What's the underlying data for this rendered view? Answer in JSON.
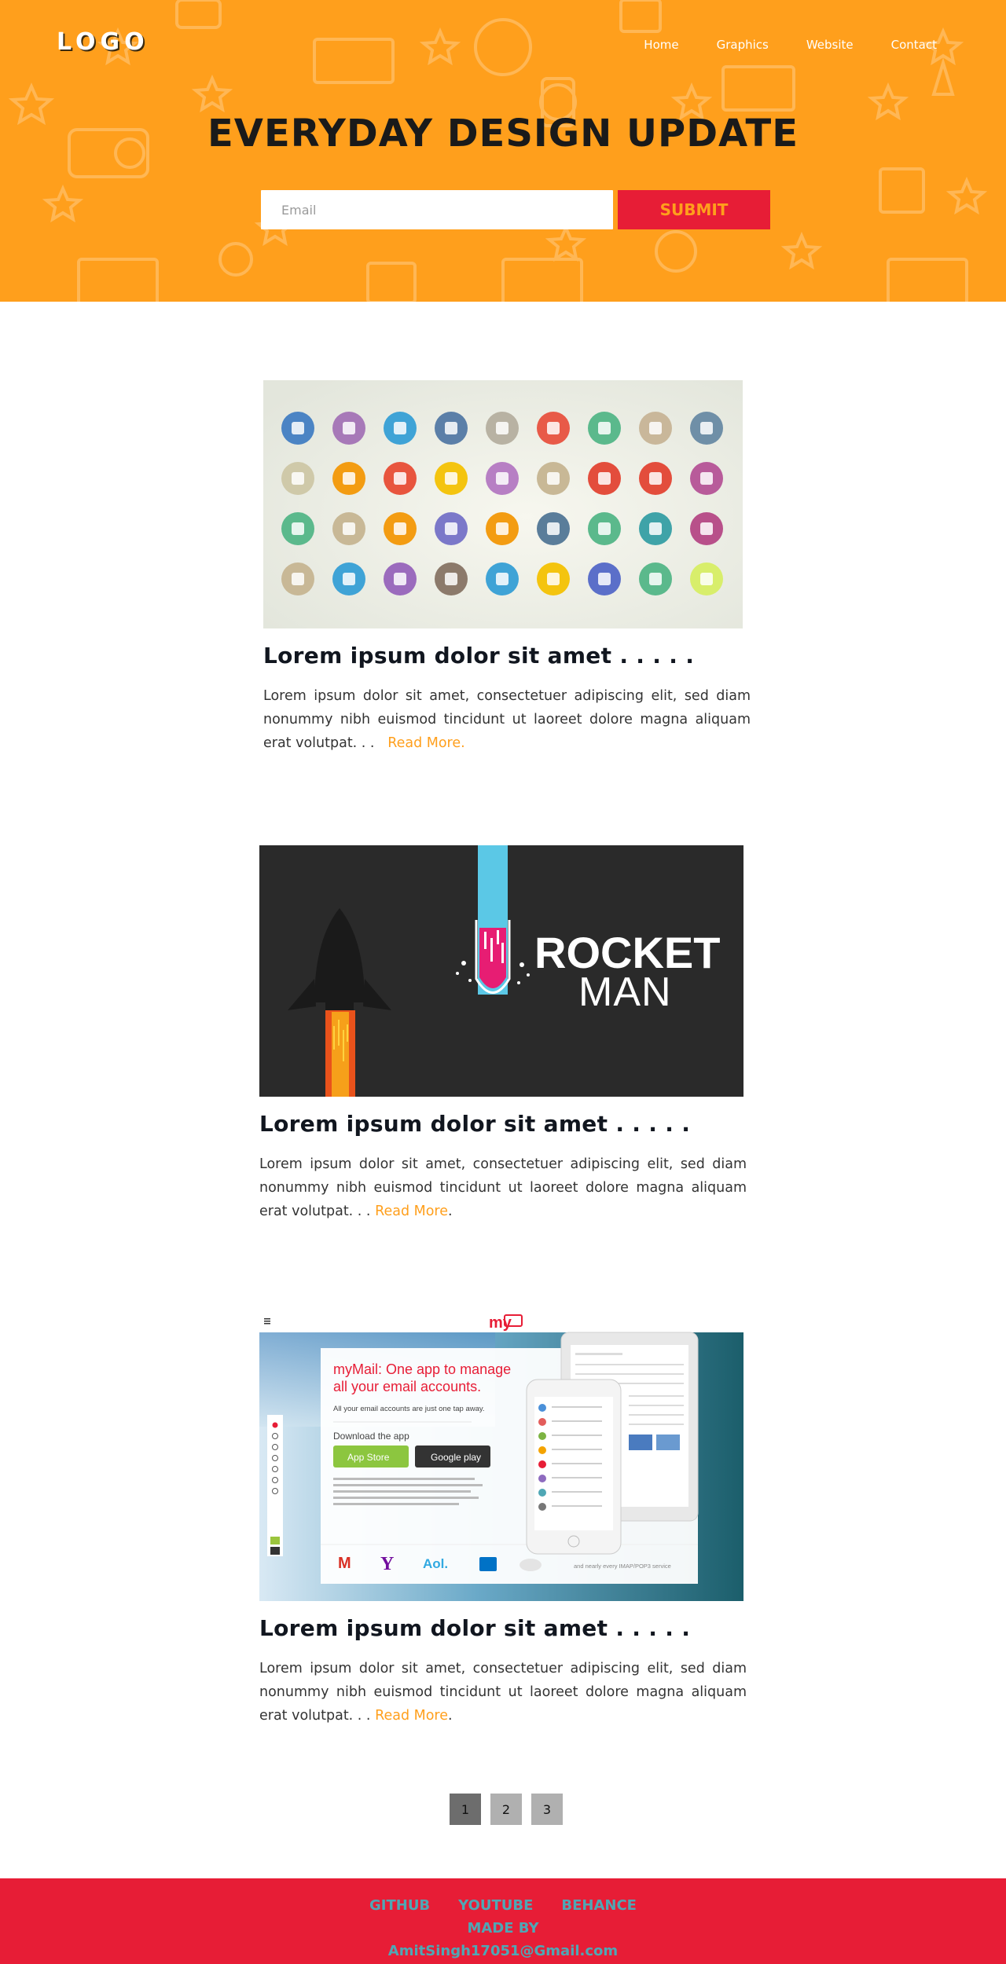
{
  "header": {
    "logo": "LOGO",
    "nav": [
      "Home",
      "Graphics",
      "Website",
      "Contact"
    ],
    "title": "EVERYDAY DESIGN UPDATE",
    "email_placeholder": "Email",
    "submit_label": "SUBMIT",
    "colors": {
      "background": "#ff9f1c",
      "submit_bg": "#e71d36",
      "submit_text": "#ff9f1c"
    }
  },
  "posts": [
    {
      "title": "Lorem ipsum dolor sit amet . . . . .",
      "text": "Lorem ipsum dolor sit amet, consectetuer adipiscing elit, sed diam nonummy nibh euismod tincidunt ut laoreet dolore magna aliquam erat volutpat. . .",
      "read_more": "Read More."
    },
    {
      "title": "Lorem ipsum dolor sit amet . . . . .",
      "text": "Lorem ipsum dolor sit amet, consectetuer adipiscing elit, sed diam nonummy nibh euismod tincidunt ut laoreet dolore magna aliquam erat volutpat. . .",
      "read_more": "Read More",
      "image_text": {
        "line1": "ROCKET",
        "line2": "MAN"
      }
    },
    {
      "title": "Lorem ipsum dolor sit amet . . . . .",
      "text": "Lorem ipsum dolor sit amet, consectetuer adipiscing elit, sed diam nonummy nibh euismod tincidunt ut laoreet dolore magna aliquam erat volutpat. . .",
      "read_more": "Read More",
      "image_text": {
        "brand": "my",
        "headline1": "myMail: One app to manage",
        "headline2": "all your email accounts.",
        "sub": "All your email accounts are just one tap away.",
        "download": "Download the app",
        "appstore": "App Store",
        "googleplay": "Google play",
        "aol": "Aol.",
        "more": "and nearly every IMAP/POP3 service"
      }
    }
  ],
  "pagination": {
    "pages": [
      "1",
      "2",
      "3"
    ],
    "active": "1"
  },
  "footer": {
    "links": [
      "GITHUB",
      "YOUTUBE",
      "BEHANCE"
    ],
    "made_by": "MADE BY",
    "email": "AmitSingh17051@Gmail.com",
    "colors": {
      "background": "#e71d36",
      "text": "#4fa7b5"
    }
  }
}
